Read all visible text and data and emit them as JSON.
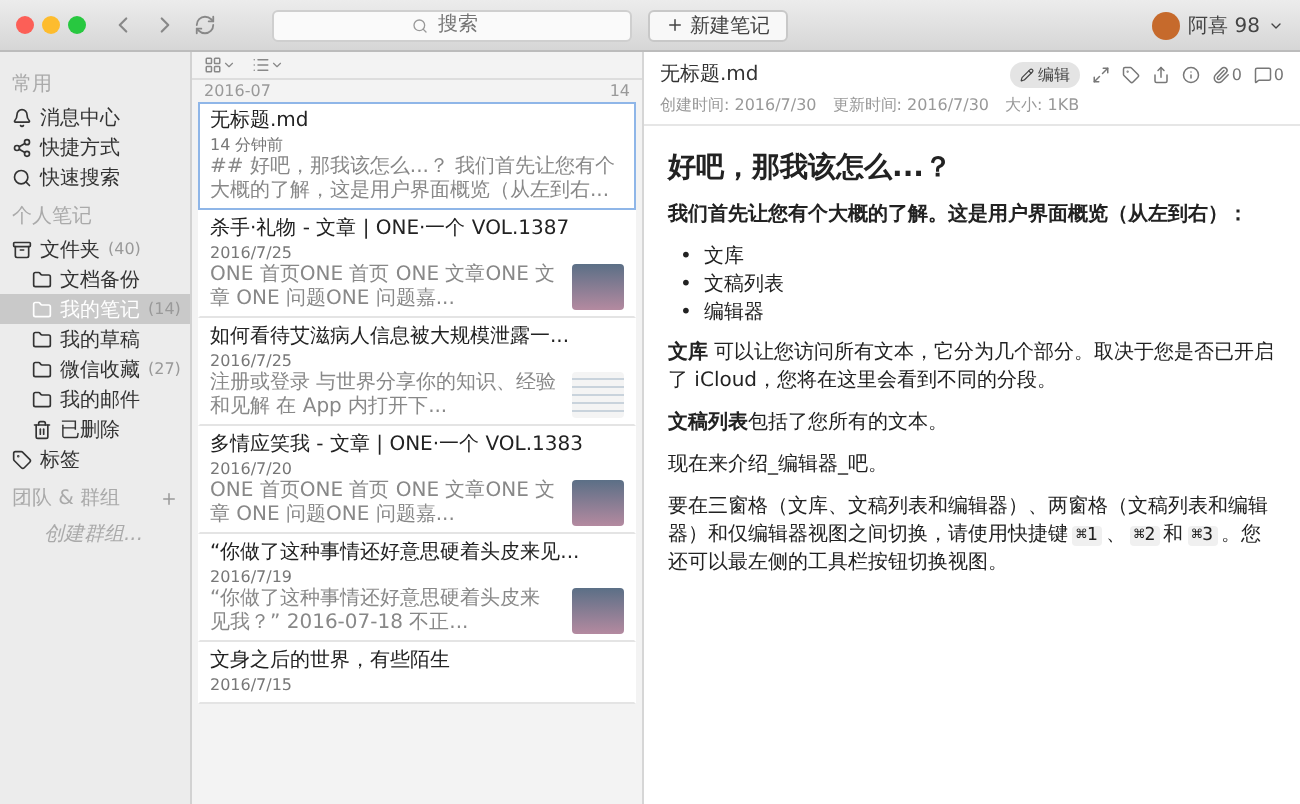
{
  "toolbar": {
    "search": {
      "placeholder": "搜索"
    },
    "new_note": "新建笔记",
    "user": "阿喜 98"
  },
  "sidebar": {
    "sections": [
      {
        "label": "常用",
        "items": [
          {
            "kind": "bell",
            "label": "消息中心",
            "selected": false
          },
          {
            "kind": "shortcut",
            "label": "快捷方式",
            "selected": false
          },
          {
            "kind": "search",
            "label": "快速搜索",
            "selected": false
          }
        ]
      },
      {
        "label": "个人笔记",
        "items": [
          {
            "kind": "library",
            "label": "文件夹",
            "count": "(40)",
            "selected": false,
            "children": [
              {
                "kind": "folder",
                "label": "文档备份",
                "selected": false
              },
              {
                "kind": "folder",
                "label": "我的笔记",
                "count": "(14)",
                "selected": true
              },
              {
                "kind": "folder",
                "label": "我的草稿",
                "selected": false
              },
              {
                "kind": "folder",
                "label": "微信收藏",
                "count": "(27)",
                "selected": false
              },
              {
                "kind": "folder",
                "label": "我的邮件",
                "selected": false
              },
              {
                "kind": "trash",
                "label": "已删除",
                "selected": false
              }
            ]
          },
          {
            "kind": "tag",
            "label": "标签",
            "selected": false
          }
        ]
      },
      {
        "label": "团队 & 群组",
        "hint": "创建群组..."
      }
    ]
  },
  "note_list": {
    "group": "2016-07",
    "count": "14",
    "notes": [
      {
        "title": "无标题.md",
        "date": "14 分钟前",
        "snippet": "## 好吧，那我该怎么...？ 我们首先让您有个大概的了解，这是用户界面概览（从左到右...",
        "selected": true
      },
      {
        "kind": "photo",
        "title": "杀手·礼物 - 文章 | ONE·一个 VOL.1387",
        "date": "2016/7/25",
        "snippet": "ONE 首页ONE 首页 ONE 文章ONE 文章 ONE 问题ONE 问题嘉...",
        "selected": false
      },
      {
        "kind": "document",
        "title": "如何看待艾滋病人信息被大规模泄露一...",
        "date": "2016/7/25",
        "snippet": "注册或登录 与世界分享你的知识、经验和见解 在 App 内打开下...",
        "selected": false
      },
      {
        "kind": "photo",
        "title": "多情应笑我 - 文章 | ONE·一个 VOL.1383",
        "date": "2016/7/20",
        "snippet": "ONE 首页ONE 首页 ONE 文章ONE 文章 ONE 问题ONE 问题嘉...",
        "selected": false
      },
      {
        "kind": "photo",
        "title": "“你做了这种事情还好意思硬着头皮来见...",
        "date": "2016/7/19",
        "snippet": "“你做了这种事情还好意思硬着头皮来见我？” 2016-07-18 不正...",
        "selected": false
      },
      {
        "title": "文身之后的世界，有些陌生",
        "date": "2016/7/15",
        "selected": false
      }
    ]
  },
  "editor": {
    "file": "无标题.md",
    "edit_button": "编辑",
    "attachments": "0",
    "comments": "0",
    "meta": [
      "创建时间: 2016/7/30",
      "更新时间: 2016/7/30",
      "大小: 1KB"
    ],
    "blocks": [
      {
        "kind": "heading",
        "text": "好吧，那我该怎么...？"
      },
      {
        "kind": "paragraph",
        "text": "**我们首先让您有个大概的了解。这是用户界面概览（从左到右）：**"
      },
      {
        "kind": "bullets",
        "items": [
          {
            "marker": "•",
            "text": "文库"
          },
          {
            "marker": "•",
            "text": "文稿列表"
          },
          {
            "marker": "•",
            "text": "编辑器"
          }
        ]
      },
      {
        "kind": "paragraph",
        "text": "**文库** 可以让您访问所有文本，它分为几个部分。取决于您是否已开启了 iCloud，您将在这里会看到不同的分段。"
      },
      {
        "kind": "paragraph",
        "text": "**文稿列表**包括了您所有的文本。"
      },
      {
        "kind": "paragraph",
        "text": "现在来介绍_编辑器_吧。"
      },
      {
        "kind": "parts",
        "parts": [
          {
            "key": false,
            "text": "要在三窗格（文库、文稿列表和编辑器）、两窗格（文稿列表和编辑器）和仅编辑器视图之间切换，请使用快捷键"
          },
          {
            "key": true,
            "text": "⌘1"
          },
          {
            "key": false,
            "text": "、"
          },
          {
            "key": true,
            "text": "⌘2"
          },
          {
            "key": false,
            "text": "和"
          },
          {
            "key": true,
            "text": "⌘3"
          },
          {
            "key": false,
            "text": "。您还可以最左侧的工具栏按钮切换视图。"
          }
        ]
      }
    ]
  }
}
